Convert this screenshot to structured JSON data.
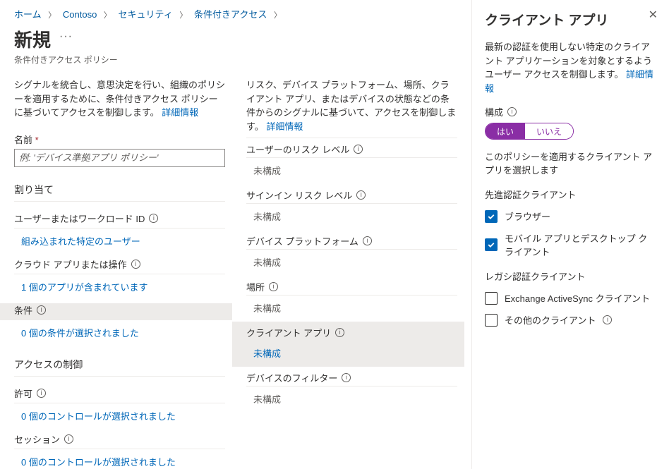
{
  "breadcrumbs": [
    "ホーム",
    "Contoso",
    "セキュリティ",
    "条件付きアクセス"
  ],
  "page": {
    "title": "新規",
    "subtitle": "条件付きアクセス ポリシー"
  },
  "left": {
    "desc_prefix": "シグナルを統合し、意思決定を行い、組織のポリシーを適用するために、条件付きアクセス ポリシーに基づいてアクセスを制御します。",
    "more_info": "詳細情報",
    "name_label": "名前",
    "name_placeholder": "例: 'デバイス準拠アプリ ポリシー'",
    "assign_header": "割り当て",
    "row1_label": "ユーザーまたはワークロード ID",
    "row1_value": "組み込まれた特定のユーザー",
    "row2_label": "クラウド アプリまたは操作",
    "row2_value": "1 個のアプリが含まれています",
    "row3_label": "条件",
    "row3_value": "0 個の条件が選択されました",
    "access_header": "アクセスの制御",
    "grant_label": "許可",
    "grant_value": "0 個のコントロールが選択されました",
    "session_label": "セッション",
    "session_value": "0 個のコントロールが選択されました"
  },
  "right": {
    "desc": "リスク、デバイス プラットフォーム、場所、クライアント アプリ、またはデバイスの状態などの条件からのシグナルに基づいて、アクセスを制御します。",
    "more_info": "詳細情報",
    "c1_label": "ユーザーのリスク レベル",
    "c1_value": "未構成",
    "c2_label": "サインイン リスク レベル",
    "c2_value": "未構成",
    "c3_label": "デバイス プラットフォーム",
    "c3_value": "未構成",
    "c4_label": "場所",
    "c4_value": "未構成",
    "c5_label": "クライアント アプリ",
    "c5_value": "未構成",
    "c6_label": "デバイスのフィルター",
    "c6_value": "未構成"
  },
  "panel": {
    "title": "クライアント アプリ",
    "desc_prefix": "最新の認証を使用しない特定のクライアント アプリケーションを対象とするようユーザー アクセスを制御します。",
    "more_info": "詳細情報",
    "configure_label": "構成",
    "toggle_yes": "はい",
    "toggle_no": "いいえ",
    "select_text": "このポリシーを適用するクライアント アプリを選択します",
    "modern_header": "先進認証クライアント",
    "chk_browser": "ブラウザー",
    "chk_mobile": "モバイル アプリとデスクトップ クライアント",
    "legacy_header": "レガシ認証クライアント",
    "chk_eas": "Exchange ActiveSync クライアント",
    "chk_other": "その他のクライアント"
  }
}
